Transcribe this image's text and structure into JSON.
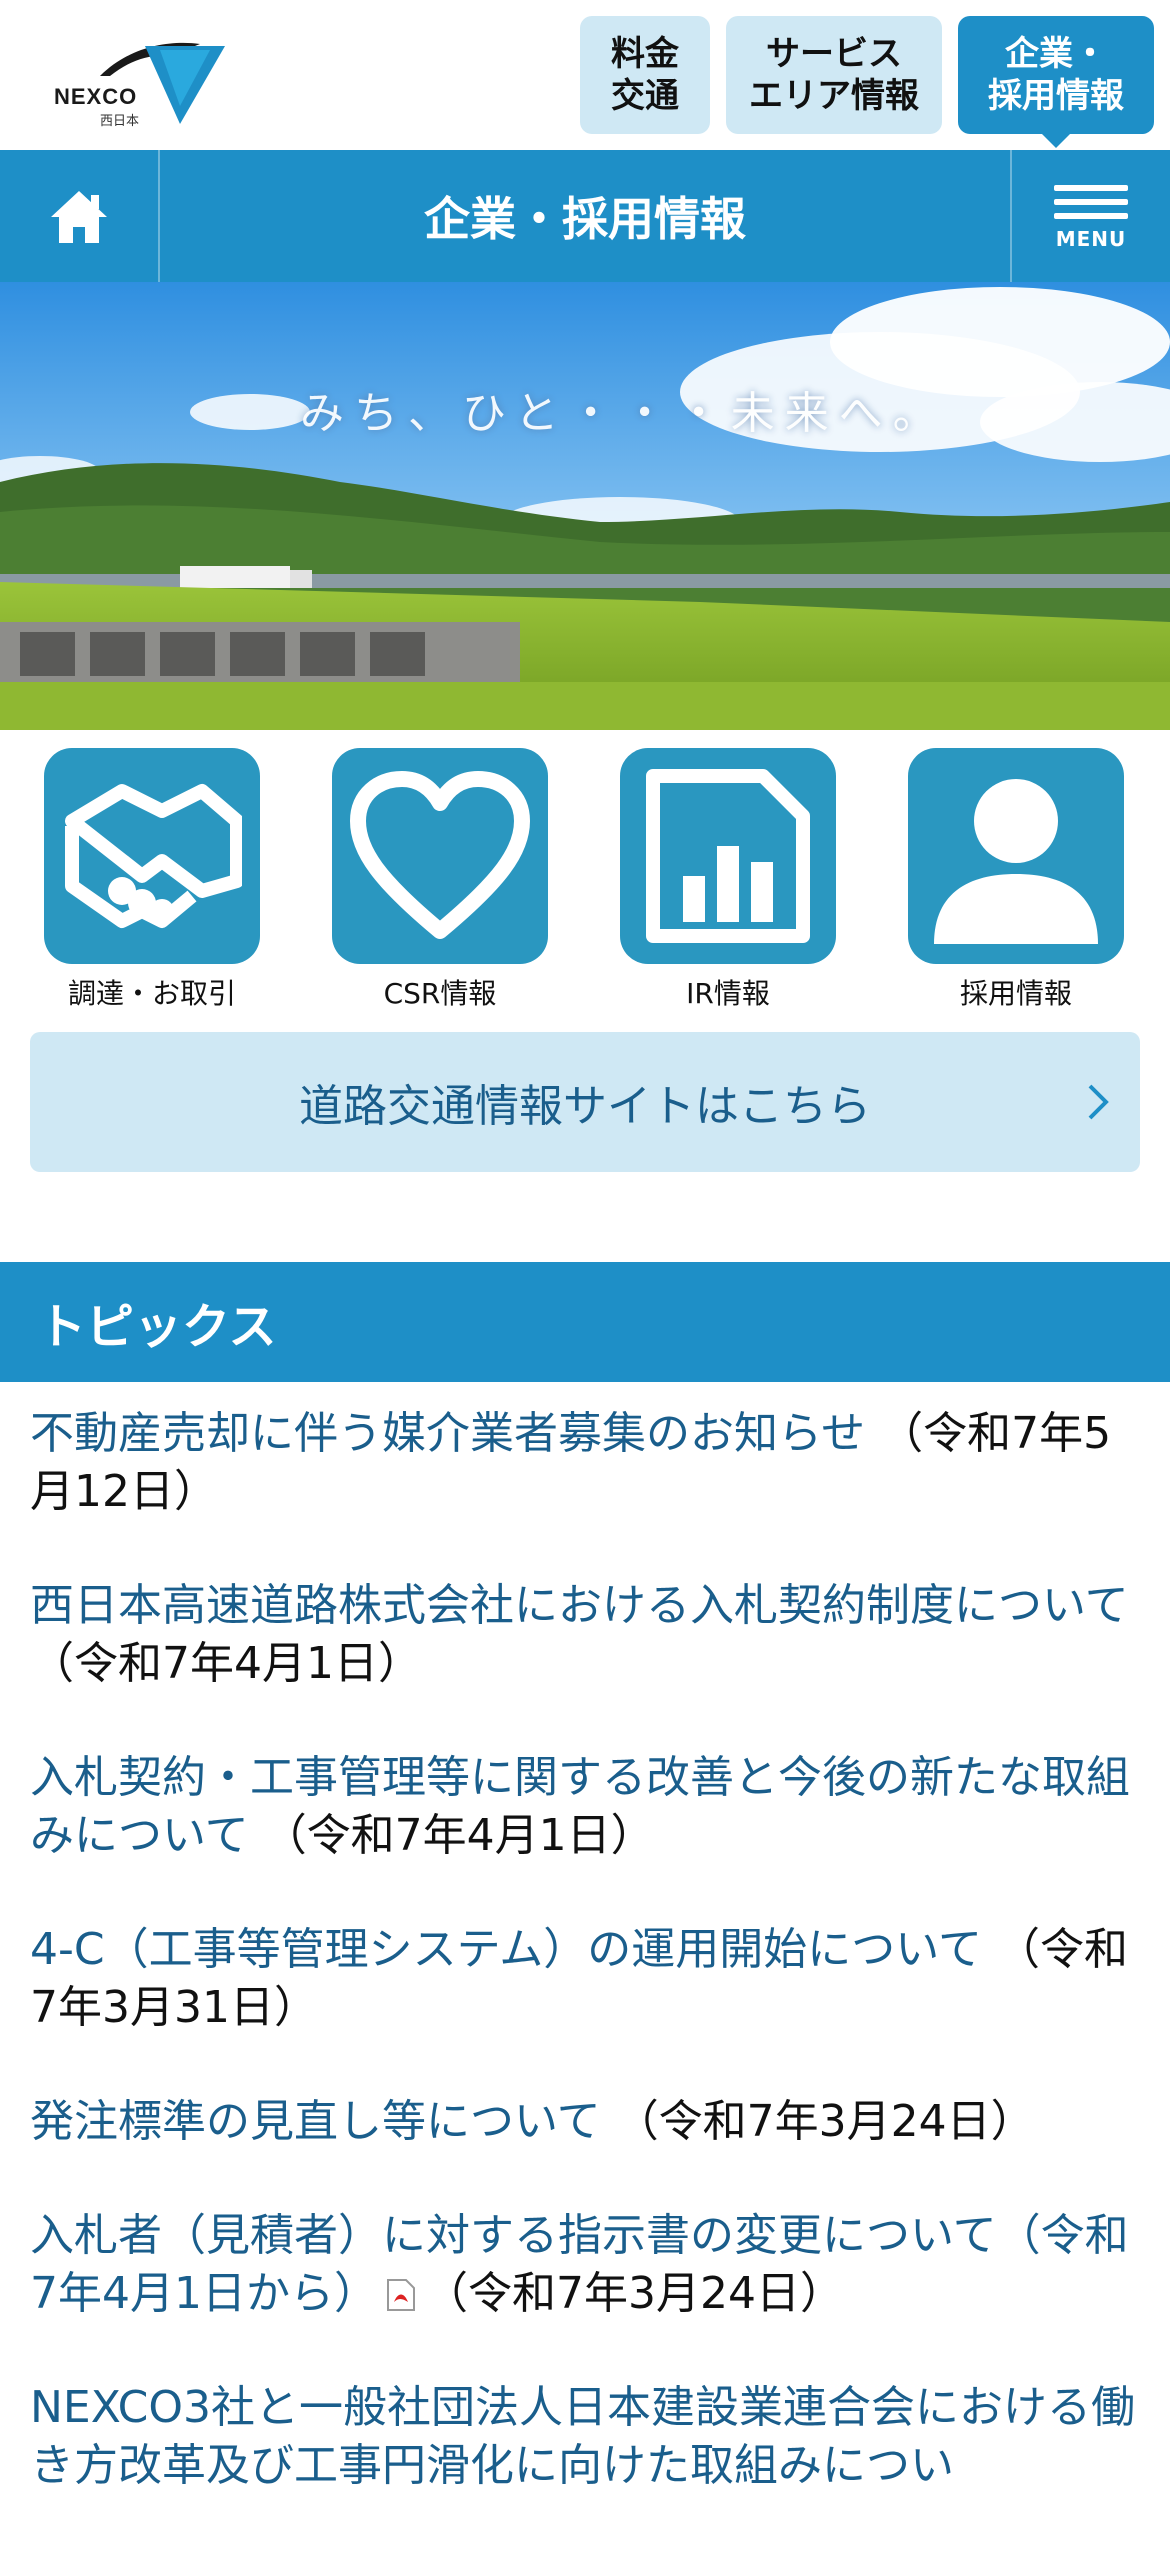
{
  "header": {
    "logo_text": "NEXCO",
    "logo_sub": "西日本",
    "buttons": [
      {
        "line1": "料金",
        "line2": "交通"
      },
      {
        "line1": "サービス",
        "line2": "エリア情報"
      },
      {
        "line1": "企業・",
        "line2": "採用情報"
      }
    ]
  },
  "navbar": {
    "title": "企業・採用情報",
    "menu_label": "MENU"
  },
  "hero": {
    "tagline": "みち、ひと・・・未来へ。"
  },
  "quick_links": [
    {
      "label": "調達・お取引",
      "icon": "handshake-icon"
    },
    {
      "label": "CSR情報",
      "icon": "heart-icon"
    },
    {
      "label": "IR情報",
      "icon": "chart-document-icon"
    },
    {
      "label": "採用情報",
      "icon": "person-icon"
    }
  ],
  "road_banner": {
    "label": "道路交通情報サイトはこちら"
  },
  "topics": {
    "heading": "トピックス",
    "items": [
      {
        "title": "不動産売却に伴う媒介業者募集のお知らせ",
        "date": "（令和7年5月12日）"
      },
      {
        "title": "西日本高速道路株式会社における入札契約制度について",
        "date": "（令和7年4月1日）"
      },
      {
        "title": "入札契約・工事管理等に関する改善と今後の新たな取組みについて",
        "date": "（令和7年4月1日）"
      },
      {
        "title": "4-C（工事等管理システム）の運用開始について",
        "date": "（令和7年3月31日）"
      },
      {
        "title": "発注標準の見直し等について",
        "date": "（令和7年3月24日）"
      },
      {
        "title": "入札者（見積者）に対する指示書の変更について（令和7年4月1日から）",
        "date": "（令和7年3月24日）",
        "pdf": true
      },
      {
        "title": "NEXCO3社と一般社団法人日本建設業連合会における働き方改革及び工事円滑化に向けた取組みについ",
        "date": ""
      }
    ]
  },
  "colors": {
    "accent": "#1e8fc7",
    "light_accent": "#cfe8f4",
    "link": "#1a5e8c",
    "icon_bg": "#2a97c0"
  }
}
